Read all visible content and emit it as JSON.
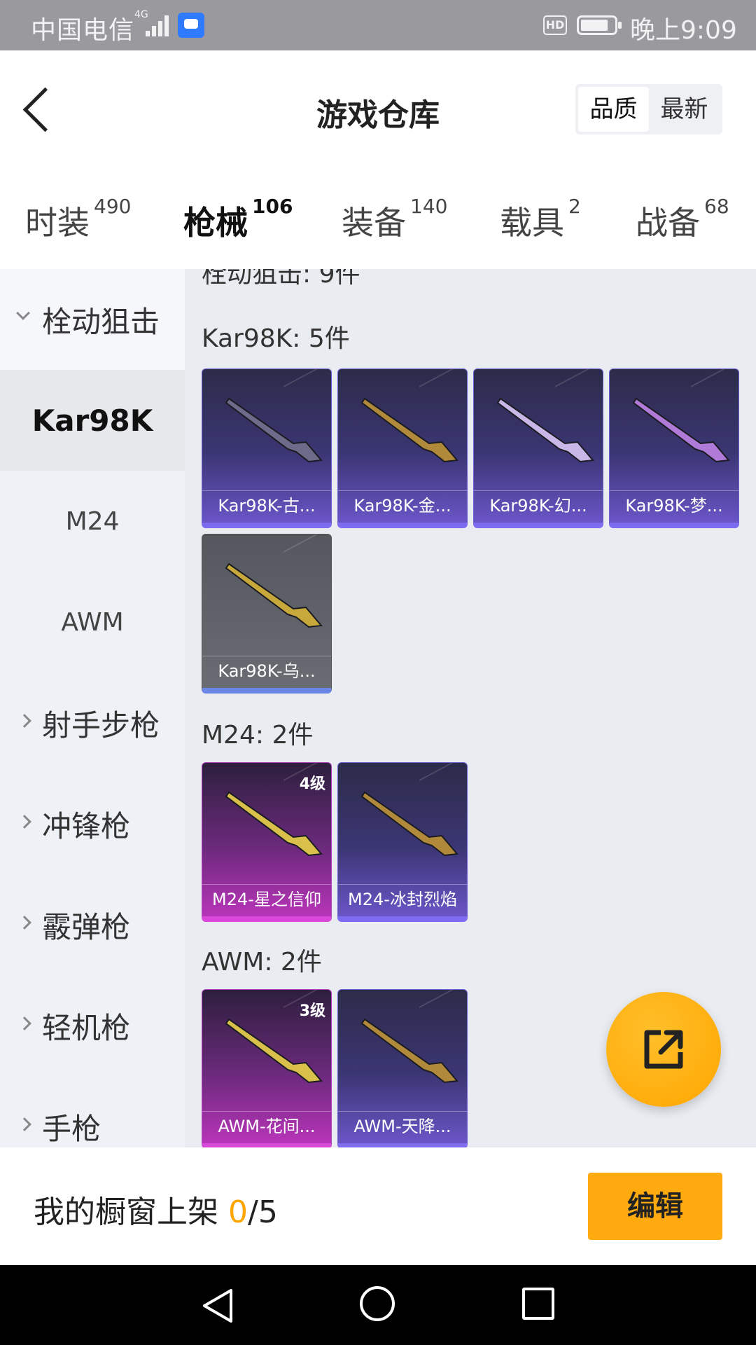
{
  "status_bar": {
    "carrier": "中国电信",
    "network": "4G",
    "hd": "HD",
    "time": "晚上9:09"
  },
  "header": {
    "title": "游戏仓库",
    "sort_options": [
      "品质",
      "最新"
    ],
    "sort_selected": "品质"
  },
  "tabs": [
    {
      "label": "时装",
      "count": "490"
    },
    {
      "label": "枪械",
      "count": "106"
    },
    {
      "label": "装备",
      "count": "140"
    },
    {
      "label": "载具",
      "count": "2"
    },
    {
      "label": "战备",
      "count": "68"
    }
  ],
  "active_tab": "枪械",
  "sidebar": {
    "group_open": "栓动狙击",
    "sub_items": [
      "Kar98K",
      "M24",
      "AWM"
    ],
    "selected_sub": "Kar98K",
    "groups": [
      "射手步枪",
      "冲锋枪",
      "霰弹枪",
      "轻机枪",
      "手枪"
    ]
  },
  "content": {
    "partial_header": "栓动狙击: 9件",
    "sections": [
      {
        "title": "Kar98K: 5件",
        "items": [
          {
            "name": "Kar98K-古...",
            "rarity": "purple",
            "level": ""
          },
          {
            "name": "Kar98K-金...",
            "rarity": "purple",
            "level": ""
          },
          {
            "name": "Kar98K-幻...",
            "rarity": "purple",
            "level": ""
          },
          {
            "name": "Kar98K-梦...",
            "rarity": "purple",
            "level": ""
          },
          {
            "name": "Kar98K-乌...",
            "rarity": "gray",
            "level": ""
          }
        ]
      },
      {
        "title": "M24: 2件",
        "items": [
          {
            "name": "M24-星之信仰",
            "rarity": "pink",
            "level": "4级"
          },
          {
            "name": "M24-冰封烈焰",
            "rarity": "purple",
            "level": ""
          }
        ]
      },
      {
        "title": "AWM: 2件",
        "items": [
          {
            "name": "AWM-花间...",
            "rarity": "pink",
            "level": "3级"
          },
          {
            "name": "AWM-天降...",
            "rarity": "purple",
            "level": ""
          }
        ]
      }
    ]
  },
  "bottom": {
    "shelf_label": "我的橱窗上架",
    "shelf_count": "0",
    "shelf_total": "/5",
    "edit_label": "编辑"
  },
  "colors": {
    "accent": "#ffab0f",
    "purple_card": "#3b3674",
    "pink_card": "#b734b8",
    "gray_card": "#6a6c73"
  },
  "icons": {
    "back": "chevron-left-icon",
    "share": "share-out-icon",
    "nav_back": "triangle-back-icon",
    "nav_home": "circle-home-icon",
    "nav_recent": "square-recent-icon"
  }
}
